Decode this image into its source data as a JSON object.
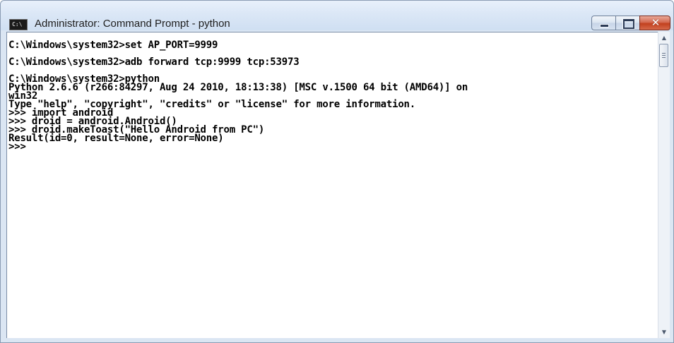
{
  "window": {
    "title": "Administrator: Command Prompt - python",
    "icon_label": "C:\\",
    "close_glyph": "✕"
  },
  "console": {
    "lines": [
      "C:\\Windows\\system32>set AP_PORT=9999",
      "",
      "C:\\Windows\\system32>adb forward tcp:9999 tcp:53973",
      "",
      "C:\\Windows\\system32>python",
      "Python 2.6.6 (r266:84297, Aug 24 2010, 18:13:38) [MSC v.1500 64 bit (AMD64)] on",
      "win32",
      "Type \"help\", \"copyright\", \"credits\" or \"license\" for more information.",
      ">>> import android",
      ">>> droid = android.Android()",
      ">>> droid.makeToast(\"Hello Android from PC\")",
      "Result(id=0, result=None, error=None)",
      ">>>"
    ]
  },
  "scrollbar": {
    "up_arrow": "▲",
    "down_arrow": "▼"
  }
}
